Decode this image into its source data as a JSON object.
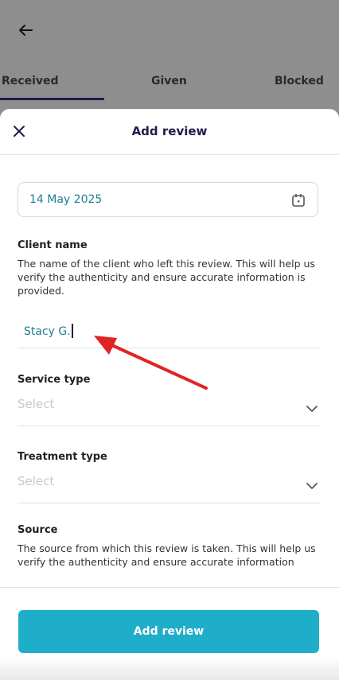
{
  "background": {
    "back_icon": "arrow-left-icon",
    "tabs": [
      {
        "label": "Received",
        "active": true
      },
      {
        "label": "Given",
        "active": false
      },
      {
        "label": "Blocked",
        "active": false
      }
    ]
  },
  "sheet": {
    "title": "Add review",
    "close_icon": "close-icon",
    "date": {
      "value": "14 May 2025",
      "icon": "calendar-icon"
    },
    "client_name": {
      "label": "Client name",
      "description": "The name of the client who left this review. This will help us verify the authenticity and ensure accurate information is provided.",
      "value": "Stacy G."
    },
    "service_type": {
      "label": "Service type",
      "placeholder": "Select",
      "icon": "chevron-down-icon"
    },
    "treatment_type": {
      "label": "Treatment type",
      "placeholder": "Select",
      "icon": "chevron-down-icon"
    },
    "source": {
      "label": "Source",
      "description": "The source from which this review is taken. This will help us verify the authenticity and ensure accurate information"
    },
    "submit_label": "Add review"
  },
  "colors": {
    "accent": "#1faec9",
    "title": "#1e1b4b",
    "value_text": "#1e7f92",
    "annotation_arrow": "#e02424"
  }
}
